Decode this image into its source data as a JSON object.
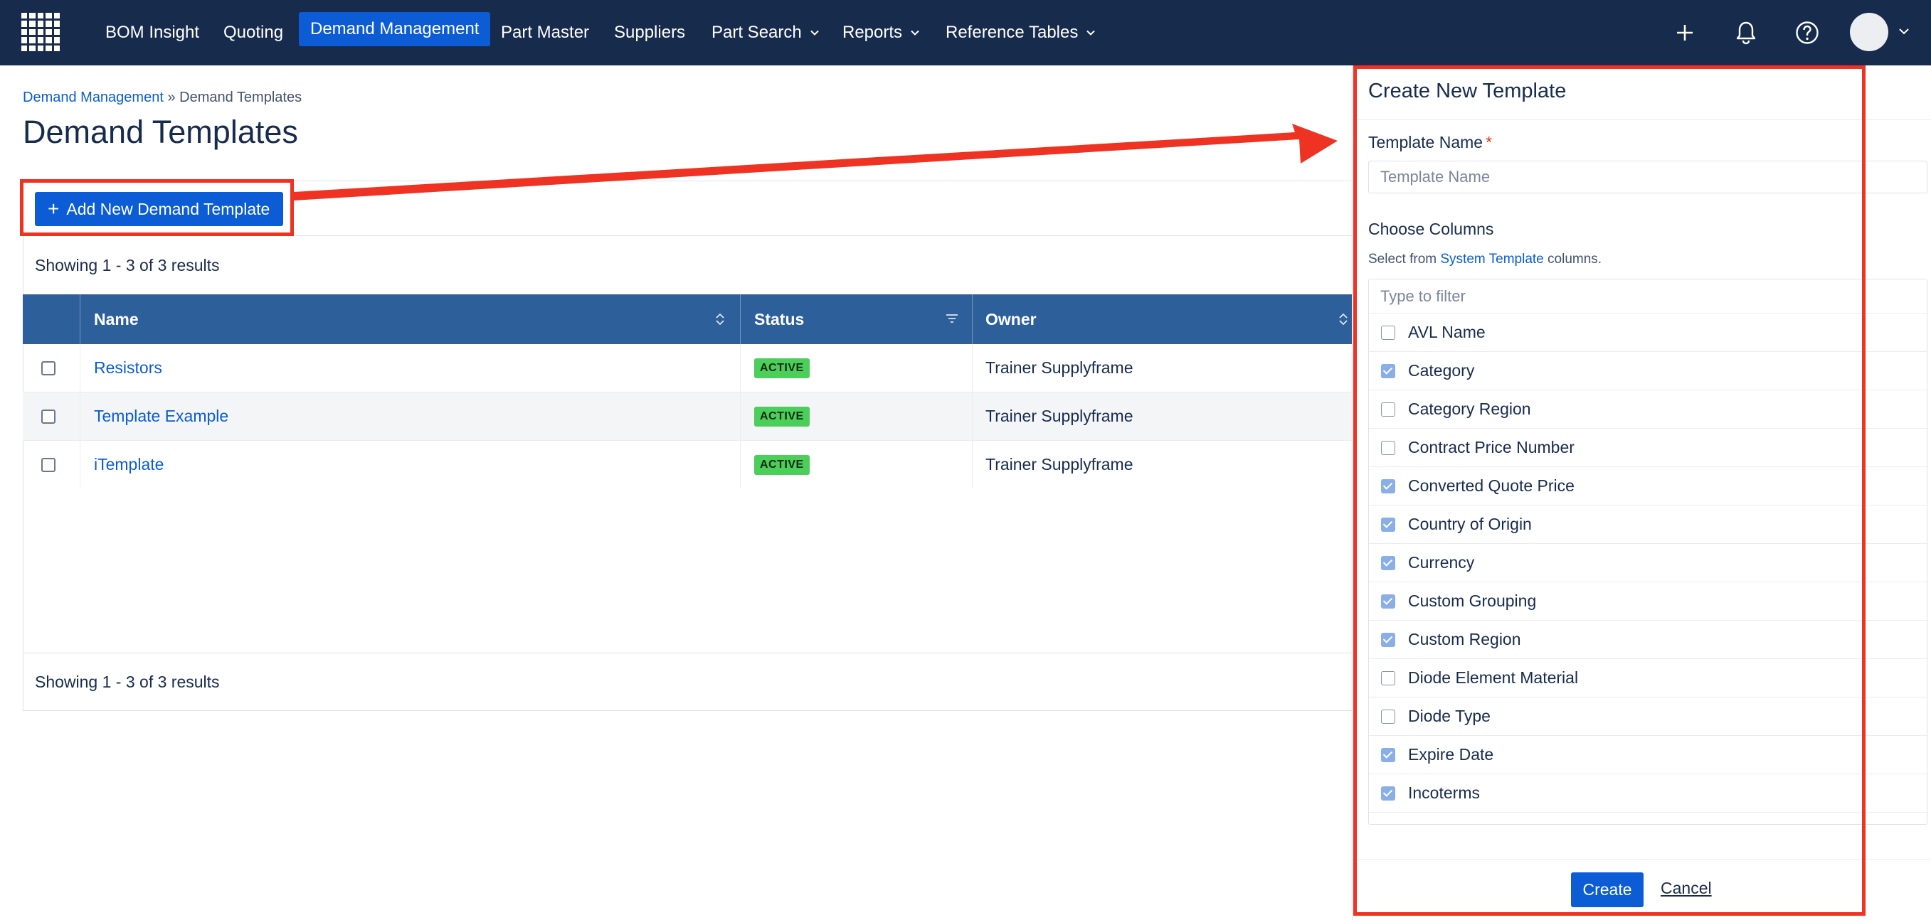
{
  "nav": {
    "items": [
      {
        "label": "BOM Insight",
        "active": false,
        "dropdown": false
      },
      {
        "label": "Quoting",
        "active": false,
        "dropdown": false
      },
      {
        "label": "Demand Management",
        "active": true,
        "dropdown": false
      },
      {
        "label": "Part Master",
        "active": false,
        "dropdown": false
      },
      {
        "label": "Suppliers",
        "active": false,
        "dropdown": false
      },
      {
        "label": "Part Search",
        "active": false,
        "dropdown": true
      },
      {
        "label": "Reports",
        "active": false,
        "dropdown": true
      },
      {
        "label": "Reference Tables",
        "active": false,
        "dropdown": true
      }
    ],
    "icons": [
      "plus-icon",
      "bell-icon",
      "help-icon",
      "avatar",
      "chevron-down-icon"
    ],
    "colors": {
      "bar": "#172b4d",
      "active": "#0b5cd5"
    }
  },
  "breadcrumb": {
    "parent": "Demand Management",
    "separator": "»",
    "current": "Demand Templates"
  },
  "page": {
    "title": "Demand Templates"
  },
  "toolbar": {
    "add_button": "Add New Demand Template"
  },
  "results": {
    "top": "Showing 1 - 3 of 3 results",
    "bottom": "Showing 1 - 3 of 3 results"
  },
  "table": {
    "columns": [
      "Name",
      "Status",
      "Owner"
    ],
    "rows": [
      {
        "name": "Resistors",
        "status": "ACTIVE",
        "owner": "Trainer Supplyframe"
      },
      {
        "name": "Template Example",
        "status": "ACTIVE",
        "owner": "Trainer Supplyframe"
      },
      {
        "name": "iTemplate",
        "status": "ACTIVE",
        "owner": "Trainer Supplyframe"
      }
    ],
    "colors": {
      "header": "#2d5f9a",
      "active_badge": "#4bce5a"
    }
  },
  "panel": {
    "title": "Create New Template",
    "name_label": "Template Name",
    "required_mark": "*",
    "name_placeholder": "Template Name",
    "choose_label": "Choose Columns",
    "helper_prefix": "Select from",
    "helper_link": "System Template",
    "helper_suffix": "columns.",
    "filter_placeholder": "Type to filter",
    "columns": [
      {
        "label": "AVL Name",
        "checked": false
      },
      {
        "label": "Category",
        "checked": true
      },
      {
        "label": "Category Region",
        "checked": false
      },
      {
        "label": "Contract Price Number",
        "checked": false
      },
      {
        "label": "Converted Quote Price",
        "checked": true
      },
      {
        "label": "Country of Origin",
        "checked": true
      },
      {
        "label": "Currency",
        "checked": true
      },
      {
        "label": "Custom Grouping",
        "checked": true
      },
      {
        "label": "Custom Region",
        "checked": true
      },
      {
        "label": "Diode Element Material",
        "checked": false
      },
      {
        "label": "Diode Type",
        "checked": false
      },
      {
        "label": "Expire Date",
        "checked": true
      },
      {
        "label": "Incoterms",
        "checked": true
      }
    ],
    "create_label": "Create",
    "cancel_label": "Cancel"
  },
  "annotation": {
    "color": "#ee3322"
  }
}
